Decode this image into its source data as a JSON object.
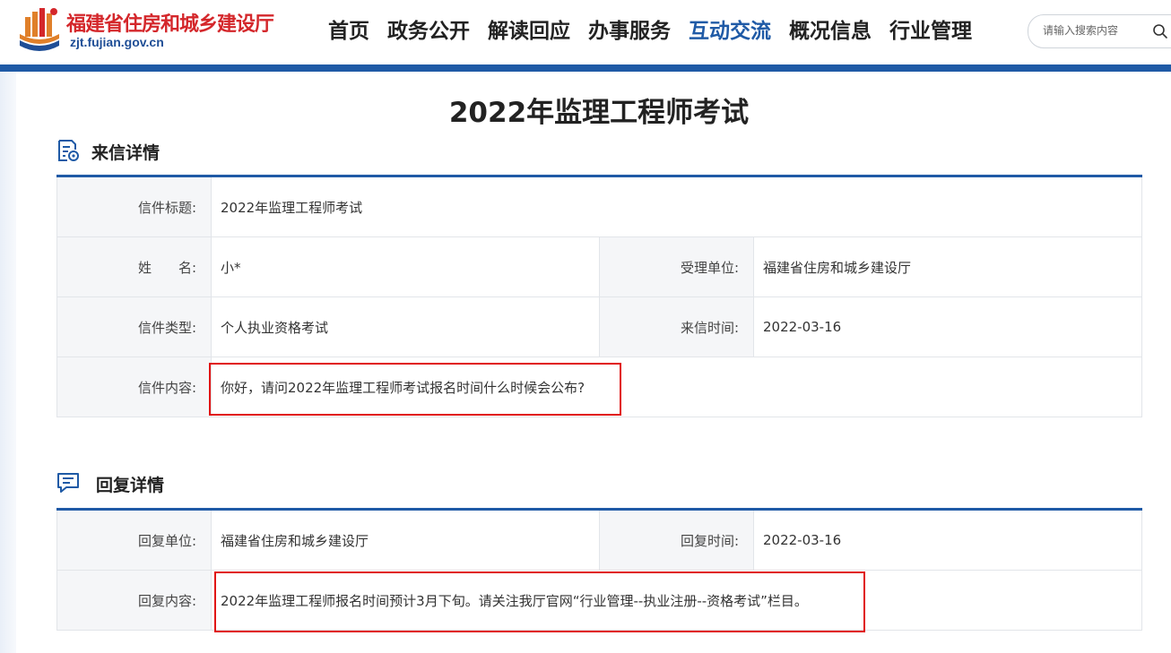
{
  "header": {
    "site_name": "福建省住房和城乡建设厅",
    "site_url": "zjt.fujian.gov.cn",
    "nav": [
      {
        "label": "首页",
        "active": false
      },
      {
        "label": "政务公开",
        "active": false
      },
      {
        "label": "解读回应",
        "active": false
      },
      {
        "label": "办事服务",
        "active": false
      },
      {
        "label": "互动交流",
        "active": true
      },
      {
        "label": "概况信息",
        "active": false
      },
      {
        "label": "行业管理",
        "active": false
      }
    ],
    "search_placeholder": "请输入搜索内容"
  },
  "page_title": "2022年监理工程师考试",
  "letter": {
    "section_title": "来信详情",
    "subject_label": "信件标题:",
    "subject_value": "2022年监理工程师考试",
    "name_label": "姓　　名:",
    "name_value": "小*",
    "dept_label": "受理单位:",
    "dept_value": "福建省住房和城乡建设厅",
    "type_label": "信件类型:",
    "type_value": "个人执业资格考试",
    "time_label": "来信时间:",
    "time_value": "2022-03-16",
    "content_label": "信件内容:",
    "content_value": "你好，请问2022年监理工程师考试报名时间什么时候会公布?"
  },
  "reply": {
    "section_title": "回复详情",
    "dept_label": "回复单位:",
    "dept_value": "福建省住房和城乡建设厅",
    "time_label": "回复时间:",
    "time_value": "2022-03-16",
    "content_label": "回复内容:",
    "content_value": "2022年监理工程师报名时间预计3月下旬。请关注我厅官网“行业管理--执业注册--资格考试”栏目。"
  },
  "colors": {
    "brand_blue": "#1f5aa6",
    "logo_red": "#d4272b",
    "highlight_red": "#e01010"
  }
}
